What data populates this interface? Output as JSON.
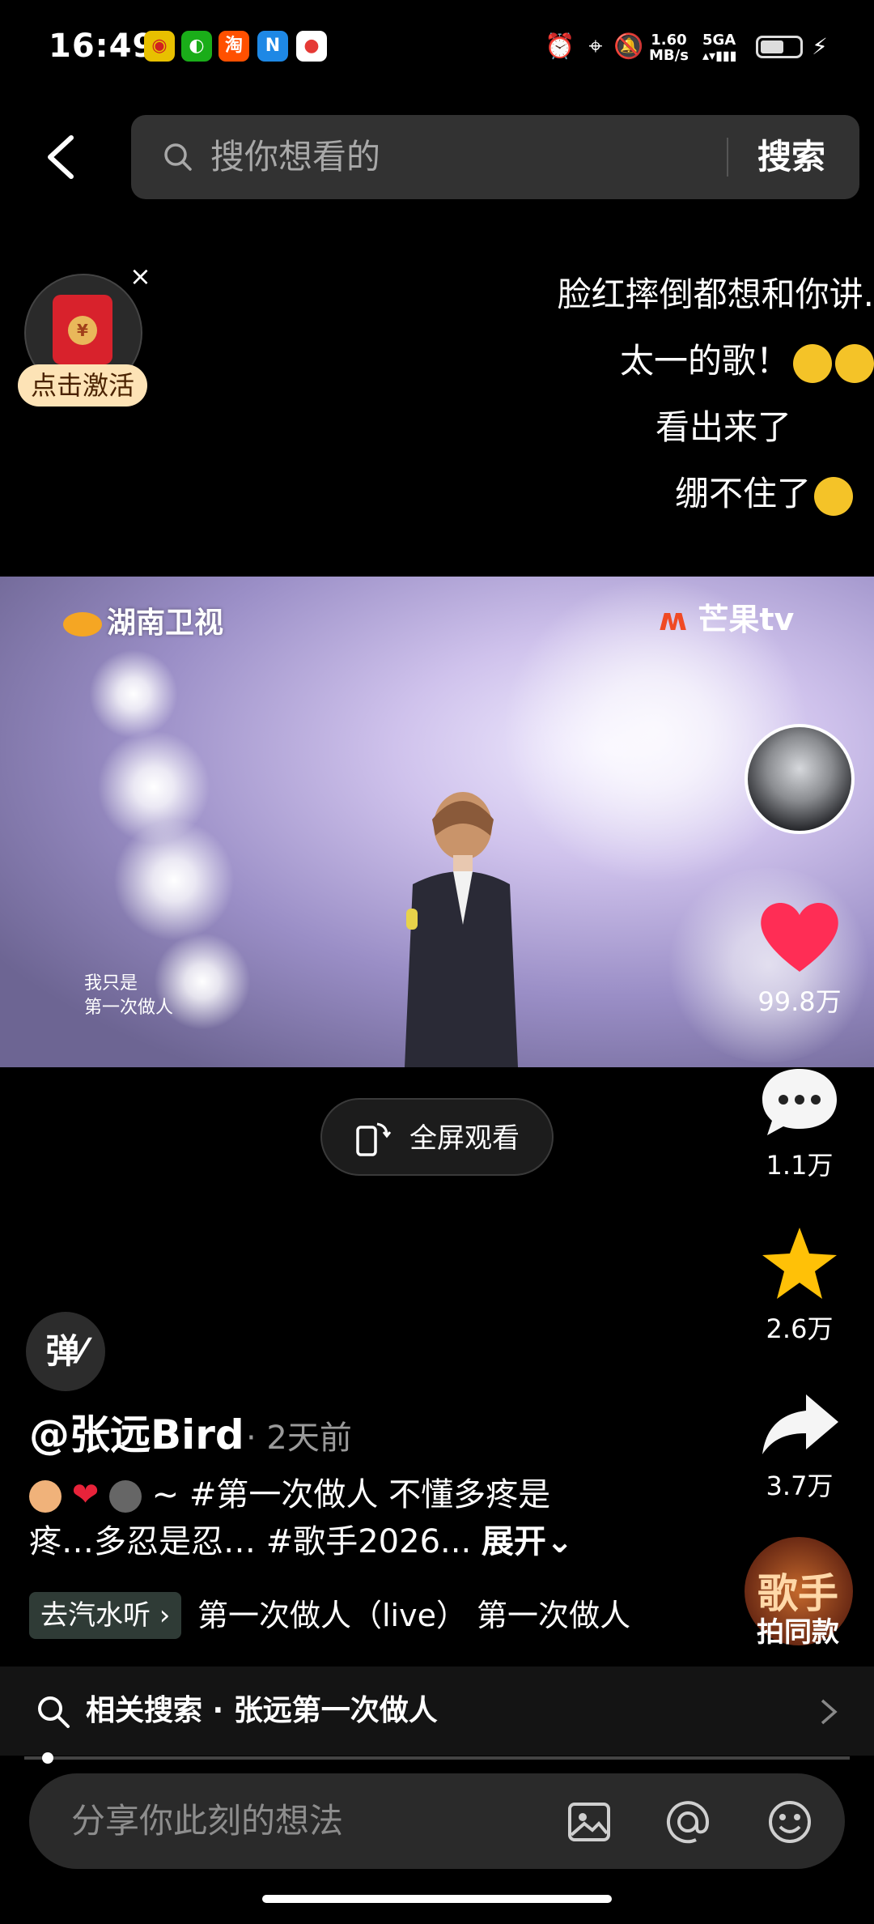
{
  "status_bar": {
    "time": "16:49",
    "speed": "1.60\nMB/s",
    "network": "5GA"
  },
  "search": {
    "placeholder": "搜你想看的",
    "button": "搜索"
  },
  "red_packet": {
    "label": "点击激活",
    "close": "×"
  },
  "lyrics": [
    "脸红摔倒都想和你讲.",
    "太一的歌！",
    "看出来了",
    "绷不住了"
  ],
  "video": {
    "channel_logo": "湖南卫视",
    "platform_logo": "芒果tv",
    "subtitle": "我只是\n第一次做人"
  },
  "actions": {
    "likes": "99.8万",
    "comments": "1.1万",
    "favorites": "2.6万",
    "shares": "3.7万",
    "album_title": "歌手",
    "album_label": "拍同款"
  },
  "fullscreen_label": "全屏观看",
  "danmu_label": "弹",
  "post": {
    "author": "@张远Bird",
    "time": "· 2天前",
    "desc_line1": "~ #第一次做人 不懂多疼是",
    "desc_line2": "疼…多忍是忍… #歌手2026...",
    "expand": "展开⌄"
  },
  "music": {
    "go_listen": "去汽水听 ›",
    "song": "第一次做人（live）   第一次做人"
  },
  "related": {
    "label": "相关搜索 · 张远第一次做人"
  },
  "comment": {
    "placeholder": "分享你此刻的想法"
  },
  "colors": {
    "like": "#ff2d55",
    "favorite": "#ffc107",
    "background": "#000000"
  }
}
